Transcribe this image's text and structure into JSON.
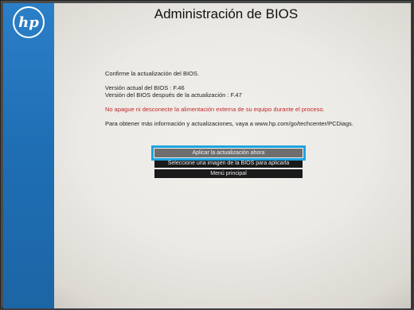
{
  "header": {
    "logo_text": "hp",
    "title": "Administración de BIOS"
  },
  "message": {
    "confirm": "Confirme la actualización del BIOS.",
    "current_version": "Versión actual del BIOS : F.46",
    "new_version": "Versión del BIOS después de la actualización : F.47",
    "warning": "No apague ni desconecte la alimentación externa de su equipo durante el proceso.",
    "info": "Para obtener más información y actualizaciones, vaya a www.hp.com/go/techcenter/PCDiags."
  },
  "menu": {
    "options": [
      "Aplicar la actualización ahora",
      "Seleccione una imagen de la BIOS para aplicarla",
      "Menú principal"
    ],
    "selected_index": 0
  },
  "colors": {
    "sidebar_blue": "#1f6fb5",
    "warning_red": "#c2262b",
    "selection_outline": "#1ea3e2"
  }
}
